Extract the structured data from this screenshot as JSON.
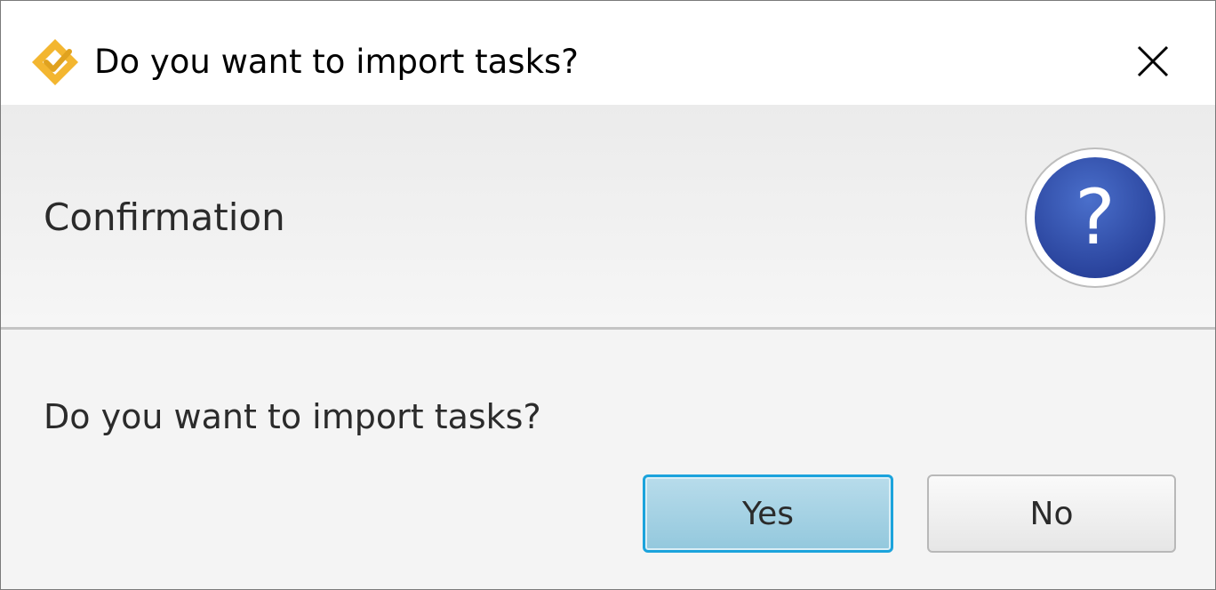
{
  "window": {
    "title": "Do you want to import tasks?",
    "app_icon": "app-logo-icon",
    "close_icon": "close-icon"
  },
  "header": {
    "title": "Confirmation",
    "icon": "question-icon",
    "icon_symbol": "?"
  },
  "content": {
    "message": "Do you want to import tasks?"
  },
  "buttons": {
    "yes_label": "Yes",
    "no_label": "No"
  },
  "colors": {
    "app_icon_accent": "#f3b630",
    "question_icon_fill": "#3452a8",
    "default_button_border": "#1ba3dc",
    "default_button_fill": "#a7d3e5"
  }
}
